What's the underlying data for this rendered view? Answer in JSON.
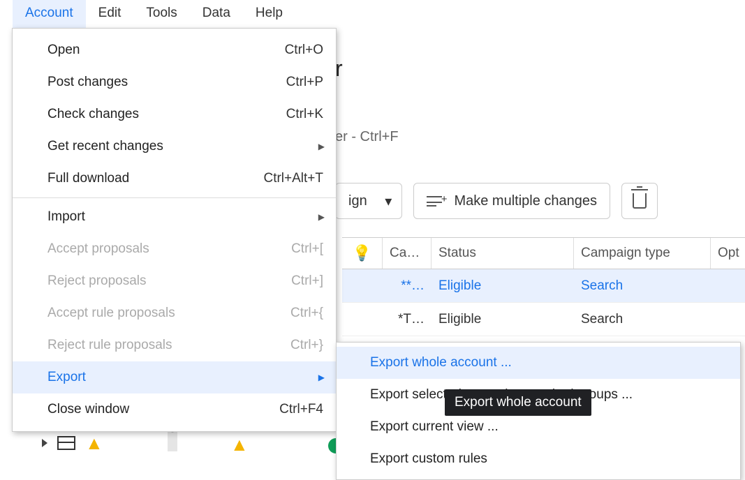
{
  "menubar": [
    "Account",
    "Edit",
    "Tools",
    "Data",
    "Help"
  ],
  "menu": {
    "open": {
      "label": "Open",
      "shortcut": "Ctrl+O"
    },
    "post": {
      "label": "Post changes",
      "shortcut": "Ctrl+P"
    },
    "check": {
      "label": "Check changes",
      "shortcut": "Ctrl+K"
    },
    "recent": {
      "label": "Get recent changes",
      "shortcut": ""
    },
    "full": {
      "label": "Full download",
      "shortcut": "Ctrl+Alt+T"
    },
    "import": {
      "label": "Import",
      "shortcut": ""
    },
    "acceptProp": {
      "label": "Accept proposals",
      "shortcut": "Ctrl+["
    },
    "rejectProp": {
      "label": "Reject proposals",
      "shortcut": "Ctrl+]"
    },
    "acceptRule": {
      "label": "Accept rule proposals",
      "shortcut": "Ctrl+{"
    },
    "rejectRule": {
      "label": "Reject rule proposals",
      "shortcut": "Ctrl+}"
    },
    "export": {
      "label": "Export",
      "shortcut": ""
    },
    "close": {
      "label": "Close window",
      "shortcut": "Ctrl+F4"
    }
  },
  "submenu": {
    "whole": "Export whole account ...",
    "selected": "Export selected campaigns and ad groups ...",
    "current": "Export current view ...",
    "custom": "Export custom rules"
  },
  "tooltip": "Export whole account",
  "titleFrag": "r",
  "filterFrag": "er - Ctrl+F",
  "toolbar": {
    "ignFrag": "ign",
    "multiple": "Make multiple changes"
  },
  "table": {
    "headers": {
      "ca": "Ca…",
      "status": "Status",
      "ctype": "Campaign type",
      "opt": "Opt"
    },
    "rows": [
      {
        "ca": "**…",
        "status": "Eligible",
        "ctype": "Search"
      },
      {
        "ca": "*T…",
        "status": "Eligible",
        "ctype": "Search"
      }
    ]
  }
}
